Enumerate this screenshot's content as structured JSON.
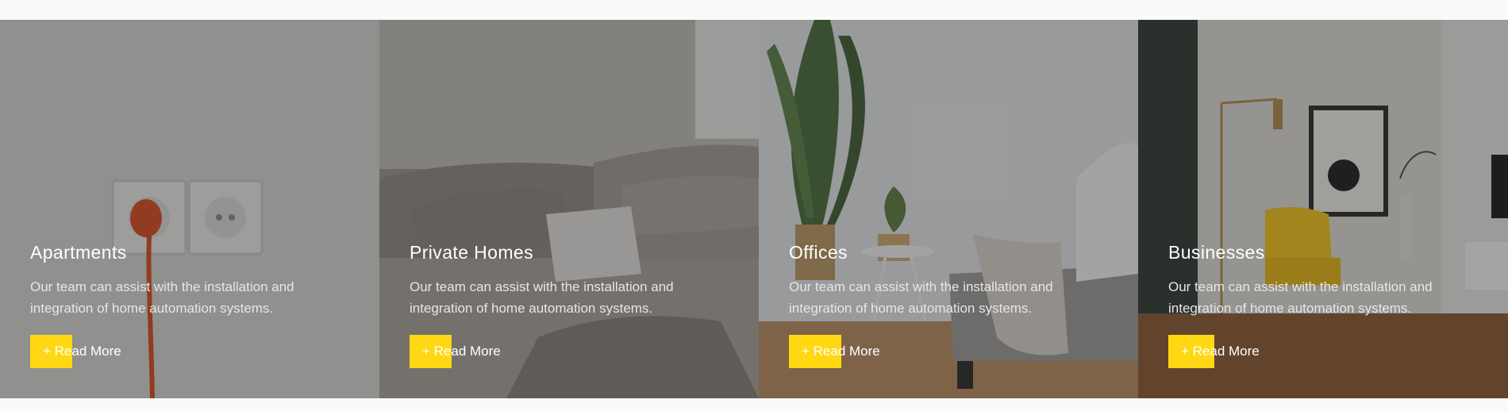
{
  "cards": [
    {
      "title": "Apartments",
      "description": "Our team can assist with the installation and integration of home automation systems.",
      "button_label": "+ Read More"
    },
    {
      "title": "Private Homes",
      "description": "Our team can assist with the installation and integration of home automation systems.",
      "button_label": "+ Read More"
    },
    {
      "title": "Offices",
      "description": "Our team can assist with the installation and integration of home automation systems.",
      "button_label": "+ Read More"
    },
    {
      "title": "Businesses",
      "description": "Our team can assist with the installation and integration of home automation systems.",
      "button_label": "+ Read More"
    }
  ],
  "colors": {
    "accent": "#ffd813",
    "text": "#ffffff",
    "overlay": "#232323"
  }
}
